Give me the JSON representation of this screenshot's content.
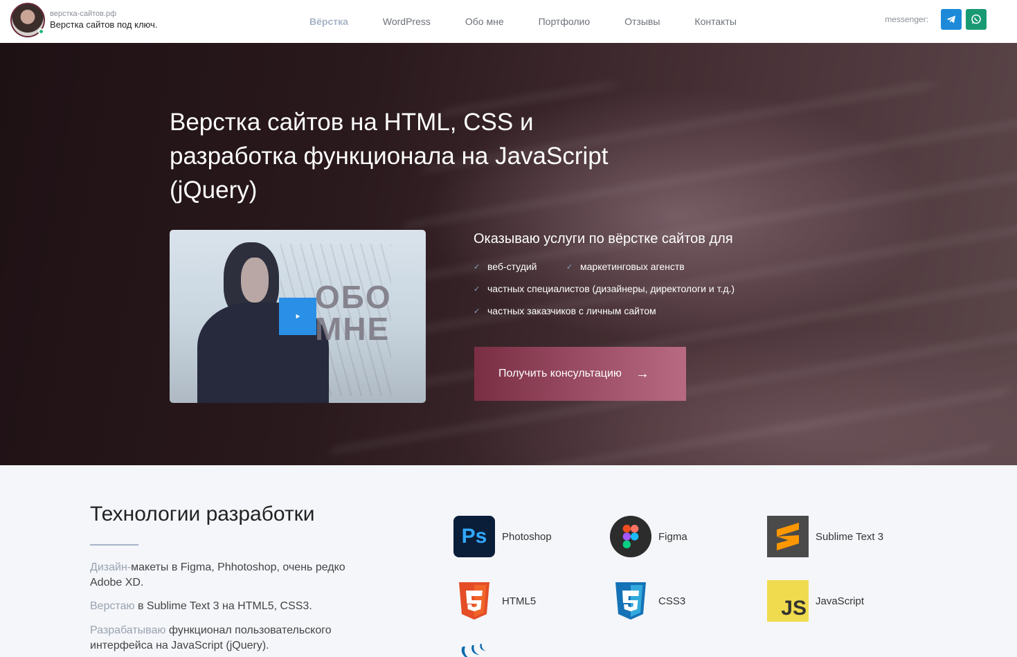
{
  "header": {
    "domain": "верстка-сайтов.рф",
    "tagline": "Верстка сайтов под ключ.",
    "nav": [
      "Вёрстка",
      "WordPress",
      "Обо мне",
      "Портфолио",
      "Отзывы",
      "Контакты"
    ],
    "messenger_label": "messenger:"
  },
  "hero": {
    "title": "Верстка сайтов на HTML, CSS и разработка функционала на JavaScript (jQuery)",
    "video_text_line1": "ОБО",
    "video_text_line2": "МНЕ",
    "services_title": "Оказываю услуги по вёрстке сайтов для",
    "services": [
      "веб-студий",
      "маркетинговых агенств",
      "частных специалистов (дизайнеры, директологи и т.д.)",
      "частных заказчиков с личным сайтом"
    ],
    "cta_label": "Получить консультацию"
  },
  "tech": {
    "title": "Технологии разработки",
    "paragraphs": [
      {
        "muted": "Дизайн-",
        "text": "макеты в Figma, Phhotoshop, очень редко Adobe XD."
      },
      {
        "muted": "Верстаю",
        "text": " в Sublime Text 3 на HTML5, CSS3."
      },
      {
        "muted": "Разрабатываю",
        "text": " функционал пользовательского интерфейса на JavaScript (jQuery)."
      }
    ],
    "tools": [
      {
        "name": "Photoshop",
        "icon": "photoshop-icon"
      },
      {
        "name": "Figma",
        "icon": "figma-icon"
      },
      {
        "name": "Sublime Text 3",
        "icon": "sublime-icon"
      },
      {
        "name": "HTML5",
        "icon": "html5-icon"
      },
      {
        "name": "CSS3",
        "icon": "css3-icon"
      },
      {
        "name": "JavaScript",
        "icon": "javascript-icon"
      }
    ]
  },
  "colors": {
    "accent_start": "#7a2e44",
    "accent_end": "#b86a82",
    "nav_active": "#a5b3c6",
    "telegram": "#1c8ad8",
    "whatsapp": "#1a9a73"
  }
}
